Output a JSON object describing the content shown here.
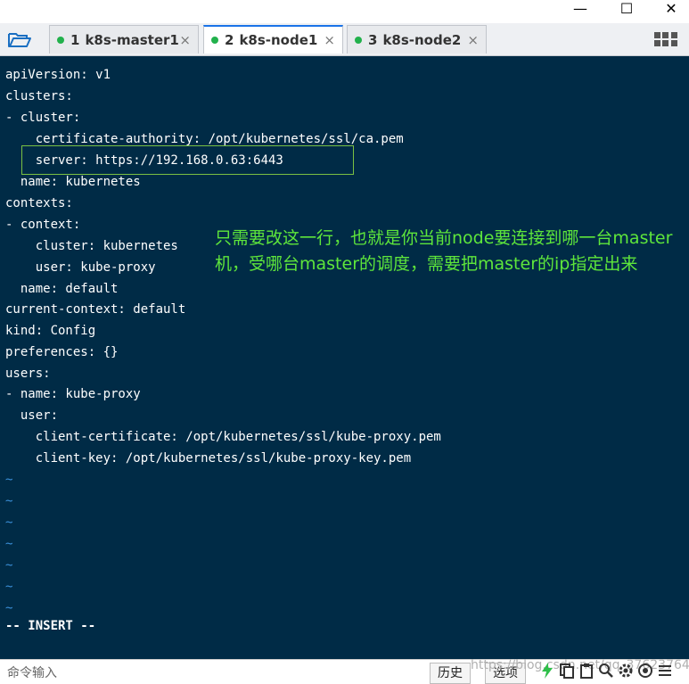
{
  "window": {
    "minimize": "—",
    "maximize": "☐",
    "close": "✕"
  },
  "tabs": [
    {
      "num": "1",
      "label": "k8s-master1",
      "close": "×"
    },
    {
      "num": "2",
      "label": "k8s-node1",
      "close": "×"
    },
    {
      "num": "3",
      "label": "k8s-node2",
      "close": "×"
    }
  ],
  "terminal": {
    "lines": [
      "apiVersion: v1",
      "clusters:",
      "- cluster:",
      "    certificate-authority: /opt/kubernetes/ssl/ca.pem",
      "    server: https://192.168.0.63:6443",
      "  name: kubernetes",
      "contexts:",
      "- context:",
      "    cluster: kubernetes",
      "    user: kube-proxy",
      "  name: default",
      "current-context: default",
      "kind: Config",
      "preferences: {}",
      "users:",
      "- name: kube-proxy",
      "  user:",
      "    client-certificate: /opt/kubernetes/ssl/kube-proxy.pem",
      "    client-key: /opt/kubernetes/ssl/kube-proxy-key.pem"
    ],
    "tildes": [
      "~",
      "~",
      "~",
      "~",
      "~",
      "~",
      "~"
    ],
    "mode": "-- INSERT --"
  },
  "annotation": "只需要改这一行，也就是你当前node要连接到哪一台master机，受哪台master的调度，需要把master的ip指定出来",
  "status": {
    "cmd_input": "命令输入",
    "history": "历史",
    "options": "选项",
    "watermark": "https://blog.csdn.net/qq_37623764"
  },
  "colors": {
    "terminal_bg": "#002b46",
    "annotation": "#5ee63b",
    "highlight_border": "#7ac143",
    "tilde": "#3a8fd8",
    "status_dot": "#22b14c"
  }
}
